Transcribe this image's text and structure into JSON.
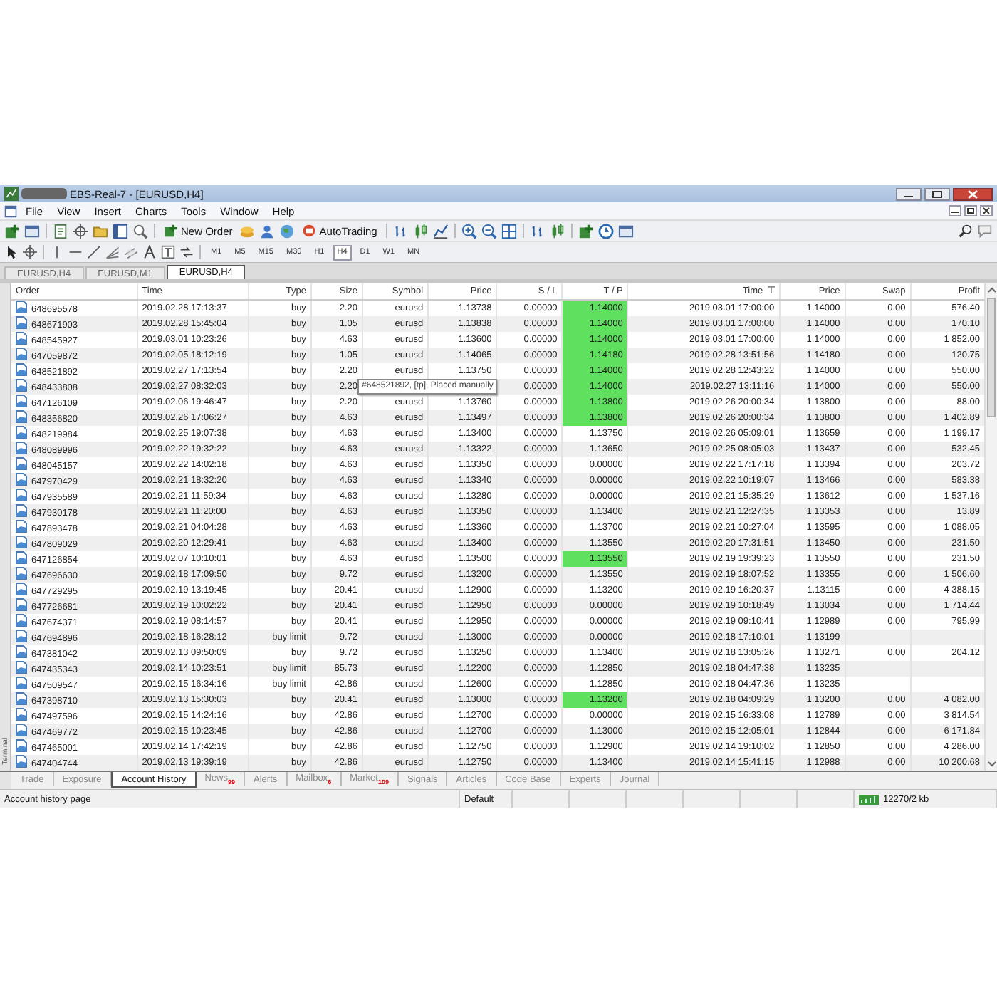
{
  "window": {
    "title": "EBS-Real-7 - [EURUSD,H4]"
  },
  "menu": [
    "File",
    "View",
    "Insert",
    "Charts",
    "Tools",
    "Window",
    "Help"
  ],
  "toolbar": {
    "new_order": "New Order",
    "auto_trading": "AutoTrading"
  },
  "timeframes": [
    {
      "label": "M1",
      "selected": false
    },
    {
      "label": "M5",
      "selected": false
    },
    {
      "label": "M15",
      "selected": false
    },
    {
      "label": "M30",
      "selected": false
    },
    {
      "label": "H1",
      "selected": false
    },
    {
      "label": "H4",
      "selected": true
    },
    {
      "label": "D1",
      "selected": false
    },
    {
      "label": "W1",
      "selected": false
    },
    {
      "label": "MN",
      "selected": false
    }
  ],
  "chart_tabs": [
    {
      "label": "EURUSD,H4",
      "selected": false
    },
    {
      "label": "EURUSD,M1",
      "selected": false
    },
    {
      "label": "EURUSD,H4",
      "selected": true
    }
  ],
  "side_label": "Terminal",
  "table": {
    "columns": [
      "Order",
      "Time",
      "Type",
      "Size",
      "Symbol",
      "Price",
      "S / L",
      "T / P",
      "Time",
      "Price",
      "Swap",
      "Profit"
    ],
    "rows": [
      {
        "order": "648695578",
        "time": "2019.02.28 17:13:37",
        "type": "buy",
        "size": "2.20",
        "symbol": "eurusd",
        "price": "1.13738",
        "sl": "0.00000",
        "tp": "1.14000",
        "tp_hit": true,
        "close_time": "2019.03.01 17:00:00",
        "close_price": "1.14000",
        "swap": "0.00",
        "profit": "576.40"
      },
      {
        "order": "648671903",
        "time": "2019.02.28 15:45:04",
        "type": "buy",
        "size": "1.05",
        "symbol": "eurusd",
        "price": "1.13838",
        "sl": "0.00000",
        "tp": "1.14000",
        "tp_hit": true,
        "close_time": "2019.03.01 17:00:00",
        "close_price": "1.14000",
        "swap": "0.00",
        "profit": "170.10"
      },
      {
        "order": "648545927",
        "time": "2019.03.01 10:23:26",
        "type": "buy",
        "size": "4.63",
        "symbol": "eurusd",
        "price": "1.13600",
        "sl": "0.00000",
        "tp": "1.14000",
        "tp_hit": true,
        "close_time": "2019.03.01 17:00:00",
        "close_price": "1.14000",
        "swap": "0.00",
        "profit": "1 852.00"
      },
      {
        "order": "647059872",
        "time": "2019.02.05 18:12:19",
        "type": "buy",
        "size": "1.05",
        "symbol": "eurusd",
        "price": "1.14065",
        "sl": "0.00000",
        "tp": "1.14180",
        "tp_hit": true,
        "close_time": "2019.02.28 13:51:56",
        "close_price": "1.14180",
        "swap": "0.00",
        "profit": "120.75"
      },
      {
        "order": "648521892",
        "time": "2019.02.27 17:13:54",
        "type": "buy",
        "size": "2.20",
        "symbol": "eurusd",
        "price": "1.13750",
        "sl": "0.00000",
        "tp": "1.14000",
        "tp_hit": true,
        "close_time": "2019.02.28 12:43:22",
        "close_price": "1.14000",
        "swap": "0.00",
        "profit": "550.00"
      },
      {
        "order": "648433808",
        "time": "2019.02.27 08:32:03",
        "type": "buy",
        "size": "2.20",
        "tooltip": "#648521892, [tp], Placed manually",
        "sl": "0.00000",
        "tp": "1.14000",
        "tp_hit": true,
        "close_time": "2019.02.27 13:11:16",
        "close_price": "1.14000",
        "swap": "0.00",
        "profit": "550.00"
      },
      {
        "order": "647126109",
        "time": "2019.02.06 19:46:47",
        "type": "buy",
        "size": "2.20",
        "symbol": "eurusd",
        "price": "1.13760",
        "sl": "0.00000",
        "tp": "1.13800",
        "tp_hit": true,
        "close_time": "2019.02.26 20:00:34",
        "close_price": "1.13800",
        "swap": "0.00",
        "profit": "88.00"
      },
      {
        "order": "648356820",
        "time": "2019.02.26 17:06:27",
        "type": "buy",
        "size": "4.63",
        "symbol": "eurusd",
        "price": "1.13497",
        "sl": "0.00000",
        "tp": "1.13800",
        "tp_hit": true,
        "close_time": "2019.02.26 20:00:34",
        "close_price": "1.13800",
        "swap": "0.00",
        "profit": "1 402.89"
      },
      {
        "order": "648219984",
        "time": "2019.02.25 19:07:38",
        "type": "buy",
        "size": "4.63",
        "symbol": "eurusd",
        "price": "1.13400",
        "sl": "0.00000",
        "tp": "1.13750",
        "tp_hit": false,
        "close_time": "2019.02.26 05:09:01",
        "close_price": "1.13659",
        "swap": "0.00",
        "profit": "1 199.17"
      },
      {
        "order": "648089996",
        "time": "2019.02.22 19:32:22",
        "type": "buy",
        "size": "4.63",
        "symbol": "eurusd",
        "price": "1.13322",
        "sl": "0.00000",
        "tp": "1.13650",
        "tp_hit": false,
        "close_time": "2019.02.25 08:05:03",
        "close_price": "1.13437",
        "swap": "0.00",
        "profit": "532.45"
      },
      {
        "order": "648045157",
        "time": "2019.02.22 14:02:18",
        "type": "buy",
        "size": "4.63",
        "symbol": "eurusd",
        "price": "1.13350",
        "sl": "0.00000",
        "tp": "0.00000",
        "tp_hit": false,
        "close_time": "2019.02.22 17:17:18",
        "close_price": "1.13394",
        "swap": "0.00",
        "profit": "203.72"
      },
      {
        "order": "647970429",
        "time": "2019.02.21 18:32:20",
        "type": "buy",
        "size": "4.63",
        "symbol": "eurusd",
        "price": "1.13340",
        "sl": "0.00000",
        "tp": "0.00000",
        "tp_hit": false,
        "close_time": "2019.02.22 10:19:07",
        "close_price": "1.13466",
        "swap": "0.00",
        "profit": "583.38"
      },
      {
        "order": "647935589",
        "time": "2019.02.21 11:59:34",
        "type": "buy",
        "size": "4.63",
        "symbol": "eurusd",
        "price": "1.13280",
        "sl": "0.00000",
        "tp": "0.00000",
        "tp_hit": false,
        "close_time": "2019.02.21 15:35:29",
        "close_price": "1.13612",
        "swap": "0.00",
        "profit": "1 537.16"
      },
      {
        "order": "647930178",
        "time": "2019.02.21 11:20:00",
        "type": "buy",
        "size": "4.63",
        "symbol": "eurusd",
        "price": "1.13350",
        "sl": "0.00000",
        "tp": "1.13400",
        "tp_hit": false,
        "close_time": "2019.02.21 12:27:35",
        "close_price": "1.13353",
        "swap": "0.00",
        "profit": "13.89"
      },
      {
        "order": "647893478",
        "time": "2019.02.21 04:04:28",
        "type": "buy",
        "size": "4.63",
        "symbol": "eurusd",
        "price": "1.13360",
        "sl": "0.00000",
        "tp": "1.13700",
        "tp_hit": false,
        "close_time": "2019.02.21 10:27:04",
        "close_price": "1.13595",
        "swap": "0.00",
        "profit": "1 088.05"
      },
      {
        "order": "647809029",
        "time": "2019.02.20 12:29:41",
        "type": "buy",
        "size": "4.63",
        "symbol": "eurusd",
        "price": "1.13400",
        "sl": "0.00000",
        "tp": "1.13550",
        "tp_hit": false,
        "close_time": "2019.02.20 17:31:51",
        "close_price": "1.13450",
        "swap": "0.00",
        "profit": "231.50"
      },
      {
        "order": "647126854",
        "time": "2019.02.07 10:10:01",
        "type": "buy",
        "size": "4.63",
        "symbol": "eurusd",
        "price": "1.13500",
        "sl": "0.00000",
        "tp": "1.13550",
        "tp_hit": true,
        "close_time": "2019.02.19 19:39:23",
        "close_price": "1.13550",
        "swap": "0.00",
        "profit": "231.50"
      },
      {
        "order": "647696630",
        "time": "2019.02.18 17:09:50",
        "type": "buy",
        "size": "9.72",
        "symbol": "eurusd",
        "price": "1.13200",
        "sl": "0.00000",
        "tp": "1.13550",
        "tp_hit": false,
        "close_time": "2019.02.19 18:07:52",
        "close_price": "1.13355",
        "swap": "0.00",
        "profit": "1 506.60"
      },
      {
        "order": "647729295",
        "time": "2019.02.19 13:19:45",
        "type": "buy",
        "size": "20.41",
        "symbol": "eurusd",
        "price": "1.12900",
        "sl": "0.00000",
        "tp": "1.13200",
        "tp_hit": false,
        "close_time": "2019.02.19 16:20:37",
        "close_price": "1.13115",
        "swap": "0.00",
        "profit": "4 388.15"
      },
      {
        "order": "647726681",
        "time": "2019.02.19 10:02:22",
        "type": "buy",
        "size": "20.41",
        "symbol": "eurusd",
        "price": "1.12950",
        "sl": "0.00000",
        "tp": "0.00000",
        "tp_hit": false,
        "close_time": "2019.02.19 10:18:49",
        "close_price": "1.13034",
        "swap": "0.00",
        "profit": "1 714.44"
      },
      {
        "order": "647674371",
        "time": "2019.02.19 08:14:57",
        "type": "buy",
        "size": "20.41",
        "symbol": "eurusd",
        "price": "1.12950",
        "sl": "0.00000",
        "tp": "0.00000",
        "tp_hit": false,
        "close_time": "2019.02.19 09:10:41",
        "close_price": "1.12989",
        "swap": "0.00",
        "profit": "795.99"
      },
      {
        "order": "647694896",
        "time": "2019.02.18 16:28:12",
        "type": "buy limit",
        "size": "9.72",
        "symbol": "eurusd",
        "price": "1.13000",
        "sl": "0.00000",
        "tp": "0.00000",
        "tp_hit": false,
        "close_time": "2019.02.18 17:10:01",
        "close_price": "1.13199"
      },
      {
        "order": "647381042",
        "time": "2019.02.13 09:50:09",
        "type": "buy",
        "size": "9.72",
        "symbol": "eurusd",
        "price": "1.13250",
        "sl": "0.00000",
        "tp": "1.13400",
        "tp_hit": false,
        "close_time": "2019.02.18 13:05:26",
        "close_price": "1.13271",
        "swap": "0.00",
        "profit": "204.12"
      },
      {
        "order": "647435343",
        "time": "2019.02.14 10:23:51",
        "type": "buy limit",
        "size": "85.73",
        "symbol": "eurusd",
        "price": "1.12200",
        "sl": "0.00000",
        "tp": "1.12850",
        "tp_hit": false,
        "close_time": "2019.02.18 04:47:38",
        "close_price": "1.13235"
      },
      {
        "order": "647509547",
        "time": "2019.02.15 16:34:16",
        "type": "buy limit",
        "size": "42.86",
        "symbol": "eurusd",
        "price": "1.12600",
        "sl": "0.00000",
        "tp": "1.12850",
        "tp_hit": false,
        "close_time": "2019.02.18 04:47:36",
        "close_price": "1.13235"
      },
      {
        "order": "647398710",
        "time": "2019.02.13 15:30:03",
        "type": "buy",
        "size": "20.41",
        "symbol": "eurusd",
        "price": "1.13000",
        "sl": "0.00000",
        "tp": "1.13200",
        "tp_hit": true,
        "close_time": "2019.02.18 04:09:29",
        "close_price": "1.13200",
        "swap": "0.00",
        "profit": "4 082.00"
      },
      {
        "order": "647497596",
        "time": "2019.02.15 14:24:16",
        "type": "buy",
        "size": "42.86",
        "symbol": "eurusd",
        "price": "1.12700",
        "sl": "0.00000",
        "tp": "0.00000",
        "tp_hit": false,
        "close_time": "2019.02.15 16:33:08",
        "close_price": "1.12789",
        "swap": "0.00",
        "profit": "3 814.54"
      },
      {
        "order": "647469772",
        "time": "2019.02.15 10:23:45",
        "type": "buy",
        "size": "42.86",
        "symbol": "eurusd",
        "price": "1.12700",
        "sl": "0.00000",
        "tp": "1.13000",
        "tp_hit": false,
        "close_time": "2019.02.15 12:05:01",
        "close_price": "1.12844",
        "swap": "0.00",
        "profit": "6 171.84"
      },
      {
        "order": "647465001",
        "time": "2019.02.14 17:42:19",
        "type": "buy",
        "size": "42.86",
        "symbol": "eurusd",
        "price": "1.12750",
        "sl": "0.00000",
        "tp": "1.12900",
        "tp_hit": false,
        "close_time": "2019.02.14 19:10:02",
        "close_price": "1.12850",
        "swap": "0.00",
        "profit": "4 286.00"
      },
      {
        "order": "647404744",
        "time": "2019.02.13 19:39:19",
        "type": "buy",
        "size": "42.86",
        "symbol": "eurusd",
        "price": "1.12750",
        "sl": "0.00000",
        "tp": "1.13400",
        "tp_hit": false,
        "close_time": "2019.02.14 15:41:15",
        "close_price": "1.12988",
        "swap": "0.00",
        "profit": "10 200.68"
      }
    ]
  },
  "bottom_tabs": [
    {
      "label": "Trade",
      "selected": false
    },
    {
      "label": "Exposure",
      "selected": false
    },
    {
      "label": "Account History",
      "selected": true
    },
    {
      "label": "News",
      "badge": "99",
      "selected": false
    },
    {
      "label": "Alerts",
      "selected": false
    },
    {
      "label": "Mailbox",
      "badge": "6",
      "selected": false
    },
    {
      "label": "Market",
      "badge": "109",
      "selected": false
    },
    {
      "label": "Signals",
      "selected": false
    },
    {
      "label": "Articles",
      "selected": false
    },
    {
      "label": "Code Base",
      "selected": false
    },
    {
      "label": "Experts",
      "selected": false
    },
    {
      "label": "Journal",
      "selected": false
    }
  ],
  "status_bar": {
    "message": "Account history page",
    "profile": "Default",
    "traffic": "12270/2 kb"
  }
}
